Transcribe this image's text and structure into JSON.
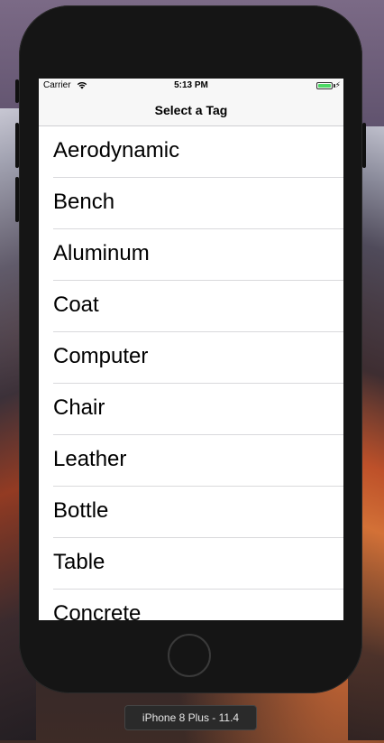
{
  "status_bar": {
    "carrier": "Carrier",
    "wifi_icon": "wifi-icon",
    "time": "5:13 PM",
    "battery_icon": "battery-icon",
    "charging_icon": "charging-bolt-icon",
    "bolt_glyph": "⚡"
  },
  "nav": {
    "title": "Select a Tag"
  },
  "tags": [
    "Aerodynamic",
    "Bench",
    "Aluminum",
    "Coat",
    "Computer",
    "Chair",
    "Leather",
    "Bottle",
    "Table",
    "Concrete"
  ],
  "device": {
    "label": "iPhone 8 Plus - 11.4"
  },
  "colors": {
    "battery_green": "#4cd964",
    "nav_background": "#f7f7f7",
    "separator": "#d9d9dc"
  }
}
